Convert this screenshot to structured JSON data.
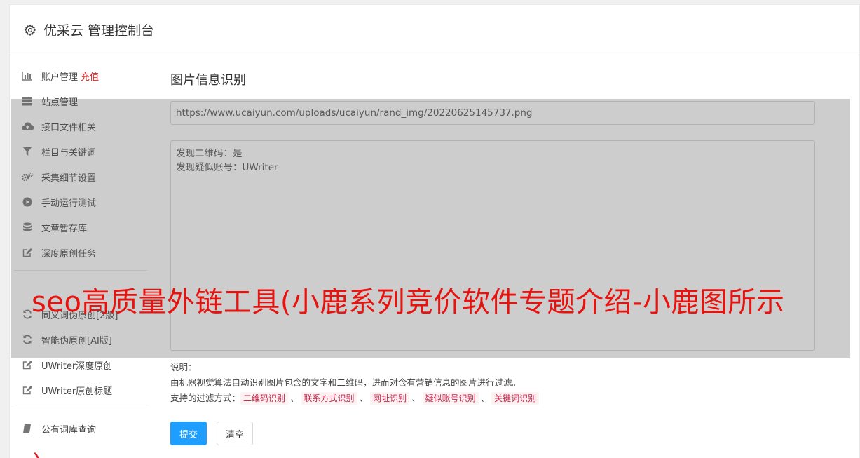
{
  "header": {
    "title": "优采云 管理控制台",
    "icon": "gear-icon"
  },
  "sidebar": {
    "items": [
      {
        "label": "账户管理",
        "accent": "充值",
        "icon": "bar-chart-icon"
      },
      {
        "label": "站点管理",
        "icon": "server-icon"
      },
      {
        "label": "接口文件相关",
        "icon": "cloud-upload-icon"
      },
      {
        "label": "栏目与关键词",
        "icon": "filter-icon"
      },
      {
        "label": "采集细节设置",
        "icon": "cogs-icon"
      },
      {
        "label": "手动运行测试",
        "icon": "play-circle-icon"
      },
      {
        "label": "文章暂存库",
        "icon": "database-icon"
      },
      {
        "label": "深度原创任务",
        "icon": "edit-icon"
      },
      {
        "label": "同义词伪原创[2版]",
        "icon": "refresh-icon"
      },
      {
        "label": "智能伪原创[AI版]",
        "icon": "refresh-icon"
      },
      {
        "label": "UWriter深度原创",
        "icon": "edit-icon"
      },
      {
        "label": "UWriter原创标题",
        "icon": "edit-icon"
      },
      {
        "label": "公有词库查询",
        "icon": "book-icon"
      }
    ]
  },
  "main": {
    "title": "图片信息识别",
    "url_value": "https://www.ucaiyun.com/uploads/ucaiyun/rand_img/20220625145737.png",
    "result_lines": [
      "发现二维码：是",
      "发现疑似账号：UWriter"
    ],
    "desc_label": "说明：",
    "desc_text": "由机器视觉算法自动识别图片包含的文字和二维码，进而对含有营销信息的图片进行过滤。",
    "filters_label": "支持的过滤方式：",
    "filters": [
      "二维码识别",
      "联系方式识别",
      "网址识别",
      "疑似账号识别",
      "关键词识别"
    ],
    "separator": "、",
    "submit_label": "提交",
    "clear_label": "清空"
  },
  "overlay": {
    "text": "seo高质量外链工具(小鹿系列竞价软件专题介绍-小鹿图所示"
  },
  "colors": {
    "primary": "#1e9fff",
    "accent": "#e02020",
    "tag_text": "#c7254e",
    "tag_bg": "#fdf2f2"
  }
}
